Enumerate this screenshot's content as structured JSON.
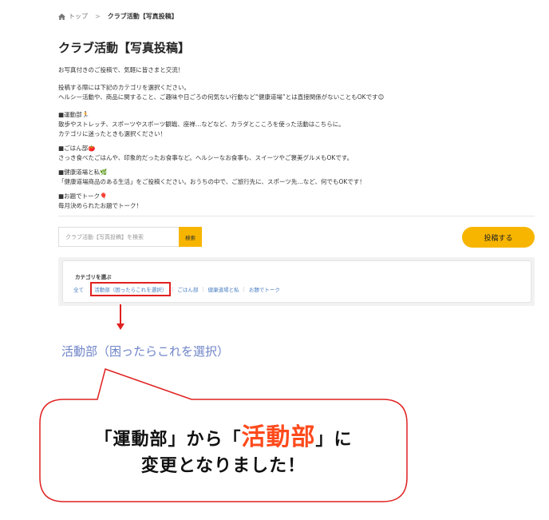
{
  "breadcrumb": {
    "home": "トップ",
    "separator": ">",
    "current": "クラブ活動【写真投稿】"
  },
  "page": {
    "title": "クラブ活動【写真投稿】"
  },
  "intro": {
    "lines": [
      "お写真付きのご投稿で、気軽に皆さまと交流！",
      "投稿する際には下記のカテゴリを選択ください。",
      "ヘルシー活動や、商品に関すること、ご趣味や日ごろの何気ない行動など“健康道場”とは直接関係がないこともOKです😊",
      "■運動部🏃",
      "散歩やストレッチ、スポーツやスポーツ観戦、座禅…などなど、カラダとこころを使った活動はこちらに。",
      "カテゴリに迷ったときも選択ください！",
      "■ごはん部🍅",
      "さっき食べたごはんや、印象的だったお食事など。ヘルシーなお食事も、スイーツやご褒美グルメもOKです。",
      "■健康道場と私🌿",
      "「健康道場商品のある生活」をご投稿ください。おうちの中で、ご旅行先に、スポーツ先…など、何でもOKです！",
      "■お題でトーク🎈",
      "毎月決められたお題でトーク！"
    ]
  },
  "search": {
    "placeholder": "クラブ活動【写真投稿】を検索",
    "button_label": "検索"
  },
  "post_button": "投稿する",
  "categories": {
    "label": "カテゴリを選ぶ",
    "items": [
      "全て",
      "活動部（困ったらこれを選択）",
      "ごはん部",
      "健康道場と私",
      "お題でトーク"
    ]
  },
  "annotation": {
    "new_name": "活動部（困ったらこれを選択）",
    "bubble": {
      "part1": "「運動部」から",
      "open_quote": "「",
      "accent": "活動部",
      "close_quote": "」に",
      "line2": "変更となりました！"
    }
  },
  "colors": {
    "accent_yellow": "#f7b500",
    "link_blue": "#4a7fc1",
    "red": "#e02020",
    "highlight_orange": "#ff4a1c",
    "annotation_blue": "#6f84c8"
  },
  "icons": {
    "home": "home-icon"
  }
}
